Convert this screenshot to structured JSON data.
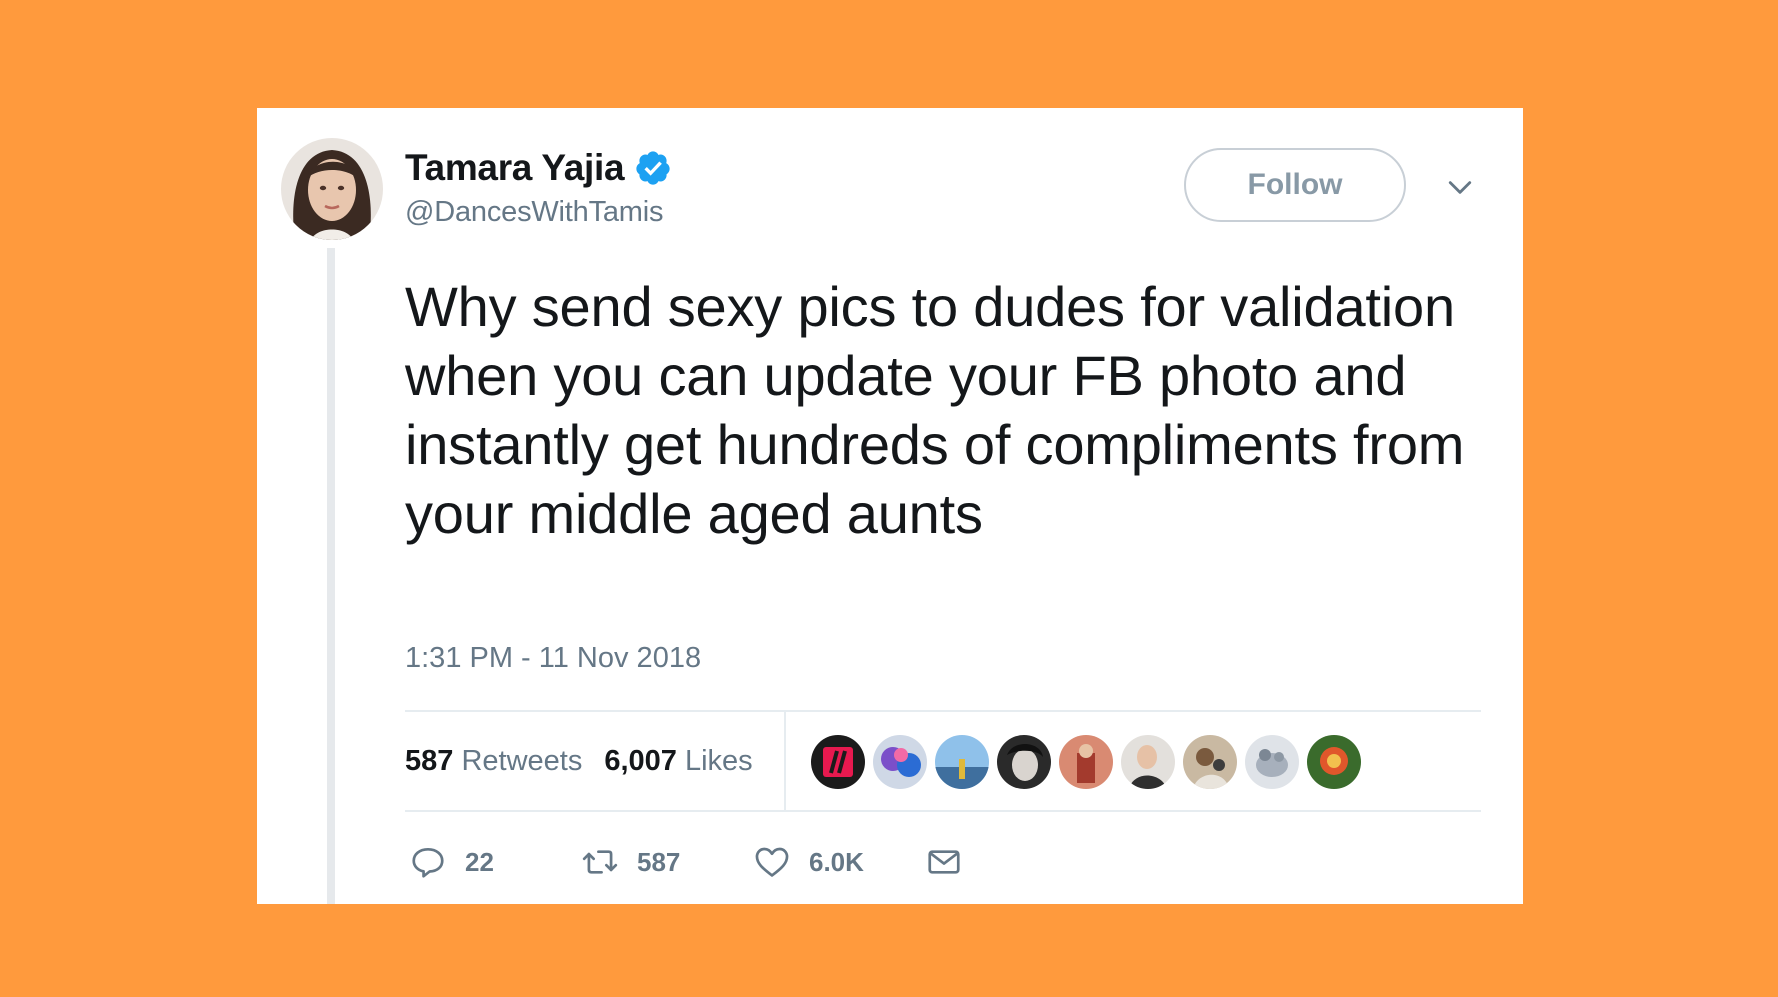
{
  "tweet": {
    "author": {
      "display_name": "Tamara Yajia",
      "handle": "@DancesWithTamis",
      "verified": true,
      "verified_color": "#1DA1F2"
    },
    "follow_label": "Follow",
    "text": "Why send sexy pics to dudes for validation when you can update your FB photo and instantly get hundreds of compliments from your middle aged aunts",
    "timestamp": "1:31 PM - 11 Nov 2018",
    "stats": {
      "retweets_count": "587",
      "retweets_label": "Retweets",
      "likes_count": "6,007",
      "likes_label": "Likes"
    },
    "actions": {
      "reply_count": "22",
      "retweet_count": "587",
      "like_count": "6.0K"
    },
    "icons": [
      "verified-badge-icon",
      "chevron-down-icon",
      "reply-icon",
      "retweet-icon",
      "heart-icon",
      "envelope-icon"
    ]
  },
  "colors": {
    "background": "#FF9A3D",
    "card": "#FFFFFF",
    "primary_text": "#14171A",
    "secondary_text": "#657786"
  }
}
